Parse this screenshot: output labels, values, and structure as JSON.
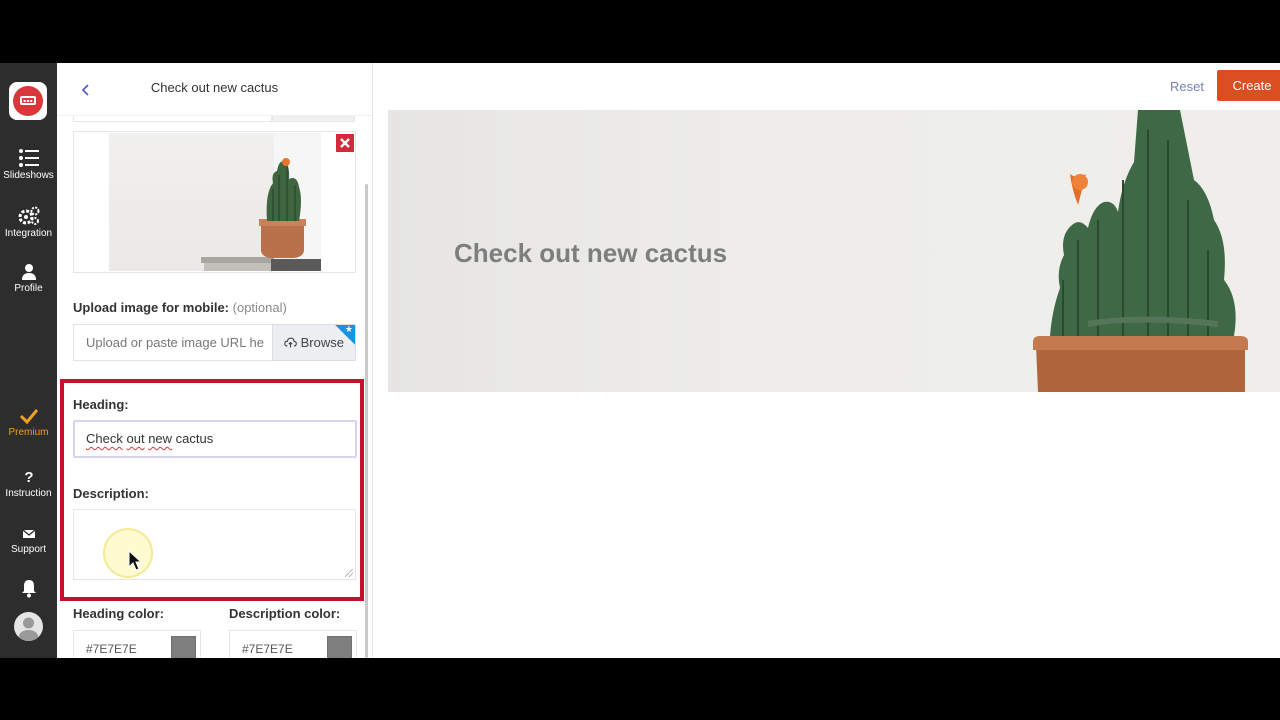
{
  "nav": {
    "items": [
      {
        "label": "Slideshows",
        "icon": "list-icon"
      },
      {
        "label": "Integration",
        "icon": "gears-icon"
      },
      {
        "label": "Profile",
        "icon": "user-icon"
      },
      {
        "label": "Premium",
        "icon": "check-icon"
      },
      {
        "label": "Instruction",
        "icon": "question-icon"
      },
      {
        "label": "Support",
        "icon": "mail-icon"
      }
    ],
    "premium_color": "#f0a020"
  },
  "panel": {
    "title": "Check out new cactus",
    "mobile_upload": {
      "label": "Upload image for mobile:",
      "optional": "(optional)",
      "placeholder": "Upload or paste image URL he",
      "browse_label": "Browse"
    },
    "heading": {
      "label": "Heading:",
      "value_words": [
        "Check",
        "out",
        "new",
        "cactus"
      ]
    },
    "description": {
      "label": "Description:",
      "value": ""
    },
    "heading_color": {
      "label": "Heading color:",
      "value": "#7E7E7E"
    },
    "description_color": {
      "label": "Description color:",
      "value": "#7E7E7E"
    }
  },
  "main": {
    "reset_label": "Reset",
    "create_label": "Create",
    "hero_title": "Check out new cactus"
  },
  "colors": {
    "accent_create": "#d94f1f",
    "highlight": "#c8102e",
    "remove": "#d12a3a",
    "sidebar_bg": "#2d2d2d"
  }
}
